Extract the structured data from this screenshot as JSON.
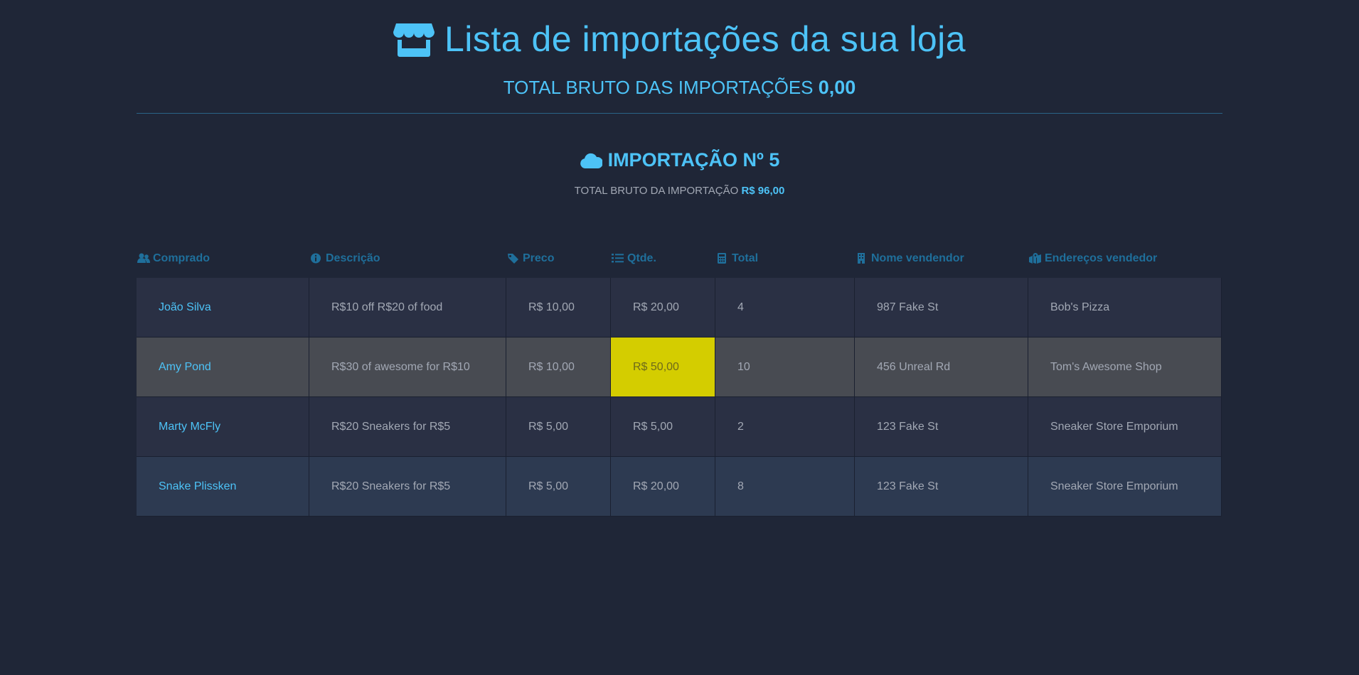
{
  "header": {
    "title": "Lista de importações da sua loja",
    "gross_label": "TOTAL BRUTO DAS IMPORTAÇÕES",
    "gross_value": "0,00",
    "store_icon": "store-icon"
  },
  "import": {
    "title": "IMPORTAÇÃO Nº 5",
    "total_label": "TOTAL BRUTO DA IMPORTAÇÃO",
    "total_value": "R$ 96,00",
    "icon": "cloud-icon"
  },
  "table": {
    "columns": [
      {
        "label": "Comprado",
        "icon": "users-icon"
      },
      {
        "label": "Descrição",
        "icon": "info-icon"
      },
      {
        "label": "Preco",
        "icon": "tag-icon"
      },
      {
        "label": "Qtde.",
        "icon": "list-icon"
      },
      {
        "label": "Total",
        "icon": "calculator-icon"
      },
      {
        "label": "Nome vendendor",
        "icon": "building-icon"
      },
      {
        "label": "Endereços vendedor",
        "icon": "map-marker-icon"
      }
    ],
    "rows": [
      {
        "buyer": "João Silva",
        "description": "R$10 off R$20 of food",
        "price": "R$ 10,00",
        "qty": "R$ 20,00",
        "total": "4",
        "seller_name": "987 Fake St",
        "seller_address": "Bob's Pizza"
      },
      {
        "buyer": "Amy Pond",
        "description": "R$30 of awesome for R$10",
        "price": "R$ 10,00",
        "qty": "R$ 50,00",
        "total": "10",
        "seller_name": "456 Unreal Rd",
        "seller_address": "Tom's Awesome Shop"
      },
      {
        "buyer": "Marty McFly",
        "description": "R$20 Sneakers for R$5",
        "price": "R$ 5,00",
        "qty": "R$ 5,00",
        "total": "2",
        "seller_name": "123 Fake St",
        "seller_address": "Sneaker Store Emporium"
      },
      {
        "buyer": "Snake Plissken",
        "description": "R$20 Sneakers for R$5",
        "price": "R$ 5,00",
        "qty": "R$ 20,00",
        "total": "8",
        "seller_name": "123 Fake St",
        "seller_address": "Sneaker Store Emporium"
      }
    ]
  },
  "colors": {
    "background": "#1f2637",
    "accent": "#4dc3f7",
    "header_text": "#1f6f9b",
    "highlight": "#d4cd00"
  }
}
